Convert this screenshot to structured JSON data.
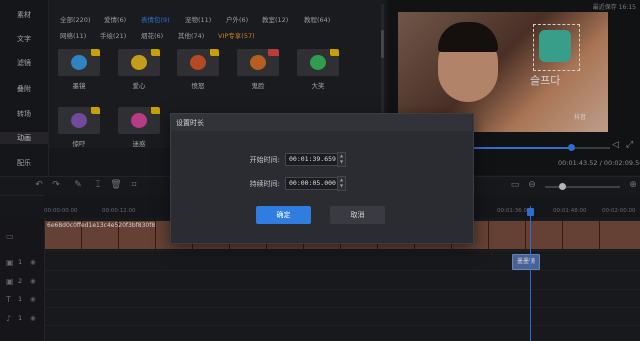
{
  "status": {
    "autosave": "最近保存 16:15"
  },
  "sidebar": {
    "items": [
      {
        "label": "素材"
      },
      {
        "label": "文字"
      },
      {
        "label": "滤镜"
      },
      {
        "label": "叠附"
      },
      {
        "label": "转场"
      },
      {
        "label": "动画"
      },
      {
        "label": "配乐"
      }
    ],
    "active_index": 5
  },
  "library": {
    "categories_row1": [
      {
        "label": "全部(220)"
      },
      {
        "label": "爱情(6)"
      },
      {
        "label": "表情包(9)"
      },
      {
        "label": "宠物(11)"
      },
      {
        "label": "户外(6)"
      },
      {
        "label": "教室(12)"
      },
      {
        "label": "教程(64)"
      }
    ],
    "categories_row2": [
      {
        "label": "网络(11)"
      },
      {
        "label": "手绘(21)"
      },
      {
        "label": "烟花(6)"
      },
      {
        "label": "其他(74)"
      },
      {
        "label": "VIP专享(57)"
      }
    ],
    "selected_category": "表情包(9)",
    "stickers_row1": [
      {
        "label": "墨镜",
        "color": "#3aa0e8",
        "badge": "crown"
      },
      {
        "label": "爱心",
        "color": "#f0c020",
        "badge": "crown"
      },
      {
        "label": "愤怒",
        "color": "#e05a2a",
        "badge": "crown"
      },
      {
        "label": "鬼脸",
        "color": "#e0722a",
        "badge": "vip"
      },
      {
        "label": "大笑",
        "color": "#3cc060",
        "badge": "crown"
      }
    ],
    "stickers_row2": [
      {
        "label": "惊吓",
        "color": "#8a5ac0",
        "badge": "crown"
      },
      {
        "label": "迷惑",
        "color": "#e04aa0",
        "badge": "crown"
      }
    ]
  },
  "preview": {
    "current_time": "00:01:43.52",
    "total_time": "00:02:09.56",
    "progress": 0.71,
    "overlay_text": "슬프다",
    "watermark": "抖音"
  },
  "timeline": {
    "ticks": [
      "00:00:00.00",
      "00:00:12.00",
      "00:01:36.00",
      "00:01:48.00",
      "00:02:00.00"
    ],
    "clip_title": "6e68d0c0ffed1e13c4e520f3bf830f8",
    "sticker_clip_label": "墨墨镜",
    "tracks": [
      {
        "num": "1",
        "type": "video"
      },
      {
        "num": "1",
        "type": "picture"
      },
      {
        "num": "2",
        "type": "picture"
      },
      {
        "num": "1",
        "type": "text"
      },
      {
        "num": "1",
        "type": "music"
      }
    ]
  },
  "modal": {
    "title": "设置时长",
    "start_label": "开始时间:",
    "start_value": "00:01:39.659",
    "duration_label": "持续时间:",
    "duration_value": "00:00:05.000",
    "confirm_label": "确定",
    "cancel_label": "取消"
  },
  "colors": {
    "accent": "#3a86ff",
    "vip": "#f0a020",
    "confirm": "#2f7de1"
  }
}
